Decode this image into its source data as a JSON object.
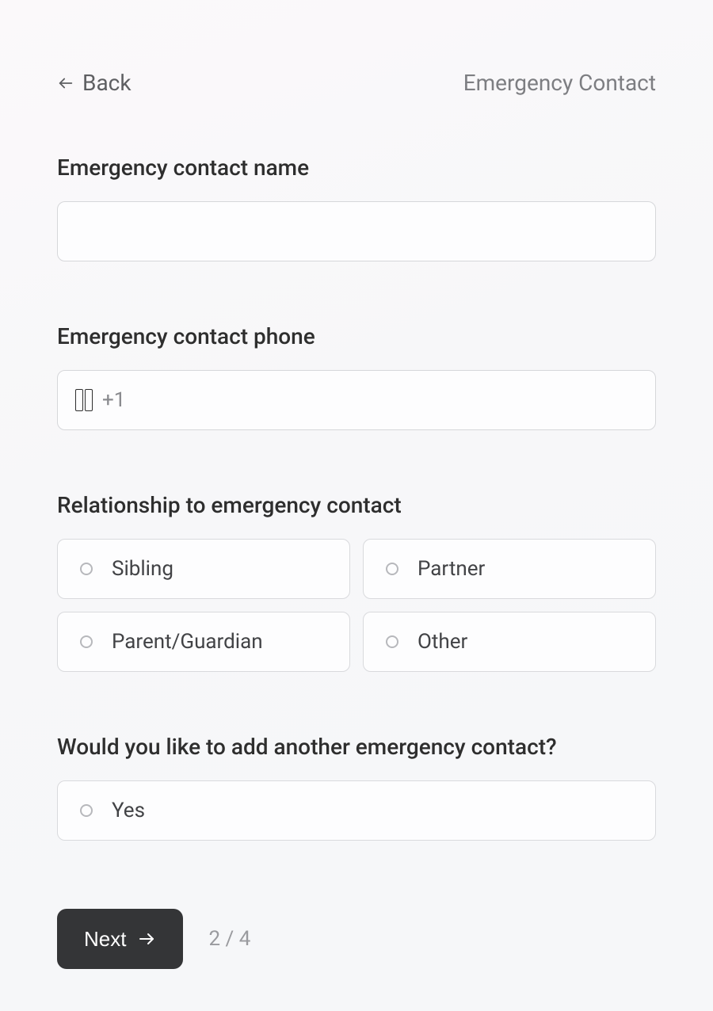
{
  "header": {
    "back_label": "Back",
    "page_title": "Emergency Contact"
  },
  "fields": {
    "name": {
      "label": "Emergency contact name",
      "value": ""
    },
    "phone": {
      "label": "Emergency contact phone",
      "dial_code": "+1",
      "value": "",
      "flag_icon": "us-flag-icon"
    },
    "relationship": {
      "label": "Relationship to emergency contact",
      "options": [
        "Sibling",
        "Partner",
        "Parent/Guardian",
        "Other"
      ]
    },
    "add_another": {
      "label": "Would you like to add another emergency contact?",
      "options": [
        "Yes"
      ]
    }
  },
  "footer": {
    "next_label": "Next",
    "step_indicator": "2 / 4"
  }
}
